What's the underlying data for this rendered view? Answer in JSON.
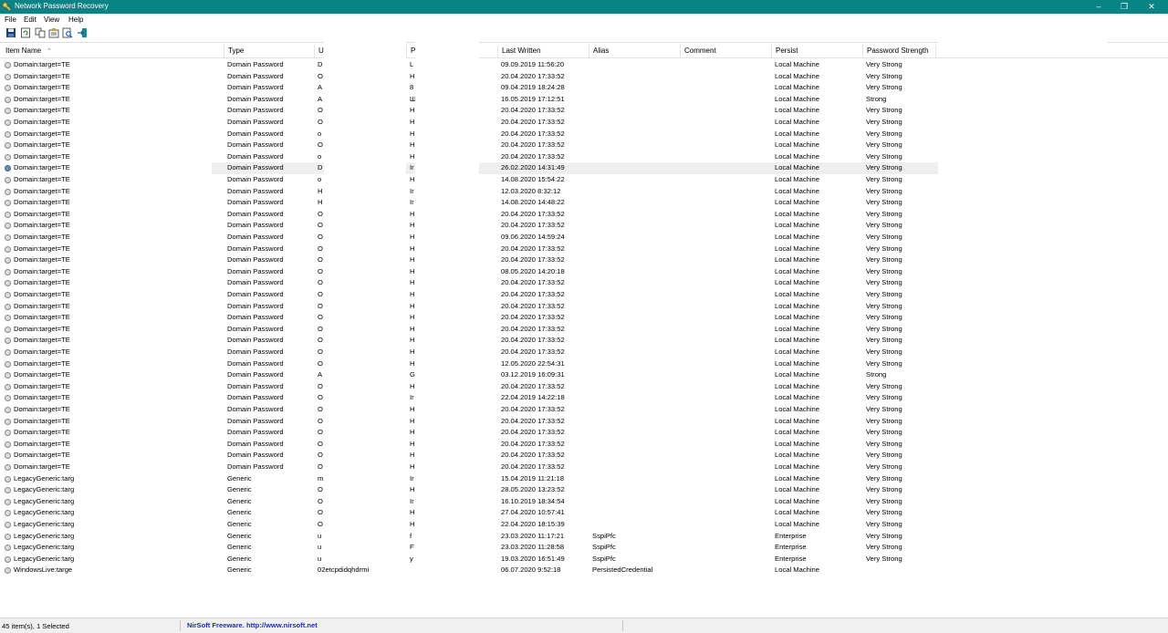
{
  "window": {
    "title": "Network Password Recovery",
    "controls": [
      "minimize",
      "maximize",
      "close"
    ]
  },
  "menu": [
    {
      "label": "File"
    },
    {
      "label": "Edit"
    },
    {
      "label": "View"
    },
    {
      "label": "Help"
    }
  ],
  "toolbar": [
    "save-icon",
    "refresh-icon",
    "copy-icon",
    "properties-icon",
    "find-icon",
    "exit-icon"
  ],
  "columns": [
    {
      "key": "name",
      "label": "Item Name"
    },
    {
      "key": "type",
      "label": "Type"
    },
    {
      "key": "user",
      "label": "U"
    },
    {
      "key": "pass",
      "label": "P"
    },
    {
      "key": "written",
      "label": "Last Written"
    },
    {
      "key": "alias",
      "label": "Alias"
    },
    {
      "key": "comment",
      "label": "Comment"
    },
    {
      "key": "persist",
      "label": "Persist"
    },
    {
      "key": "strength",
      "label": "Password Strength"
    }
  ],
  "sort_indicator": "⌃",
  "rows": [
    {
      "name": "Domain:target=TE",
      "type": "Domain Password",
      "user": "D",
      "pass": "L",
      "written": "09.09.2019 11:56:20",
      "alias": "",
      "persist": "Local Machine",
      "strength": "Very Strong"
    },
    {
      "name": "Domain:target=TE",
      "type": "Domain Password",
      "user": "O",
      "pass": "H",
      "written": "20.04.2020 17:33:52",
      "alias": "",
      "persist": "Local Machine",
      "strength": "Very Strong"
    },
    {
      "name": "Domain:target=TE",
      "type": "Domain Password",
      "user": "A",
      "pass": "8",
      "written": "09.04.2019 18:24:28",
      "alias": "",
      "persist": "Local Machine",
      "strength": "Very Strong"
    },
    {
      "name": "Domain:target=TE",
      "type": "Domain Password",
      "user": "A",
      "pass": "Ш",
      "written": "16.05.2019 17:12:51",
      "alias": "",
      "persist": "Local Machine",
      "strength": "Strong"
    },
    {
      "name": "Domain:target=TE",
      "type": "Domain Password",
      "user": "O",
      "pass": "H",
      "written": "20.04.2020 17:33:52",
      "alias": "",
      "persist": "Local Machine",
      "strength": "Very Strong"
    },
    {
      "name": "Domain:target=TE",
      "type": "Domain Password",
      "user": "O",
      "pass": "H",
      "written": "20.04.2020 17:33:52",
      "alias": "",
      "persist": "Local Machine",
      "strength": "Very Strong"
    },
    {
      "name": "Domain:target=TE",
      "type": "Domain Password",
      "user": "o",
      "pass": "H",
      "written": "20.04.2020 17:33:52",
      "alias": "",
      "persist": "Local Machine",
      "strength": "Very Strong"
    },
    {
      "name": "Domain:target=TE",
      "type": "Domain Password",
      "user": "O",
      "pass": "H",
      "written": "20.04.2020 17:33:52",
      "alias": "",
      "persist": "Local Machine",
      "strength": "Very Strong"
    },
    {
      "name": "Domain:target=TE",
      "type": "Domain Password",
      "user": "o",
      "pass": "H",
      "written": "20.04.2020 17:33:52",
      "alias": "",
      "persist": "Local Machine",
      "strength": "Very Strong"
    },
    {
      "name": "Domain:target=TE",
      "type": "Domain Password",
      "user": "D",
      "pass": "Ir",
      "written": "26.02.2020 14:31:49",
      "alias": "",
      "persist": "Local Machine",
      "strength": "Very Strong",
      "selected": true
    },
    {
      "name": "Domain:target=TE",
      "type": "Domain Password",
      "user": "o",
      "pass": "H",
      "written": "14.08.2020 15:54:22",
      "alias": "",
      "persist": "Local Machine",
      "strength": "Very Strong"
    },
    {
      "name": "Domain:target=TE",
      "type": "Domain Password",
      "user": "H",
      "pass": "Ir",
      "written": "12.03.2020 8:32:12",
      "alias": "",
      "persist": "Local Machine",
      "strength": "Very Strong"
    },
    {
      "name": "Domain:target=TE",
      "type": "Domain Password",
      "user": "H",
      "pass": "Ir",
      "written": "14.08.2020 14:48:22",
      "alias": "",
      "persist": "Local Machine",
      "strength": "Very Strong"
    },
    {
      "name": "Domain:target=TE",
      "type": "Domain Password",
      "user": "O",
      "pass": "H",
      "written": "20.04.2020 17:33:52",
      "alias": "",
      "persist": "Local Machine",
      "strength": "Very Strong"
    },
    {
      "name": "Domain:target=TE",
      "type": "Domain Password",
      "user": "O",
      "pass": "H",
      "written": "20.04.2020 17:33:52",
      "alias": "",
      "persist": "Local Machine",
      "strength": "Very Strong"
    },
    {
      "name": "Domain:target=TE",
      "type": "Domain Password",
      "user": "O",
      "pass": "H",
      "written": "09.06.2020 14:59:24",
      "alias": "",
      "persist": "Local Machine",
      "strength": "Very Strong"
    },
    {
      "name": "Domain:target=TE",
      "type": "Domain Password",
      "user": "O",
      "pass": "H",
      "written": "20.04.2020 17:33:52",
      "alias": "",
      "persist": "Local Machine",
      "strength": "Very Strong"
    },
    {
      "name": "Domain:target=TE",
      "type": "Domain Password",
      "user": "O",
      "pass": "H",
      "written": "20.04.2020 17:33:52",
      "alias": "",
      "persist": "Local Machine",
      "strength": "Very Strong"
    },
    {
      "name": "Domain:target=TE",
      "type": "Domain Password",
      "user": "O",
      "pass": "H",
      "written": "08.05.2020 14:20:18",
      "alias": "",
      "persist": "Local Machine",
      "strength": "Very Strong"
    },
    {
      "name": "Domain:target=TE",
      "type": "Domain Password",
      "user": "O",
      "pass": "H",
      "written": "20.04.2020 17:33:52",
      "alias": "",
      "persist": "Local Machine",
      "strength": "Very Strong"
    },
    {
      "name": "Domain:target=TE",
      "type": "Domain Password",
      "user": "O",
      "pass": "H",
      "written": "20.04.2020 17:33:52",
      "alias": "",
      "persist": "Local Machine",
      "strength": "Very Strong"
    },
    {
      "name": "Domain:target=TE",
      "type": "Domain Password",
      "user": "O",
      "pass": "H",
      "written": "20.04.2020 17:33:52",
      "alias": "",
      "persist": "Local Machine",
      "strength": "Very Strong"
    },
    {
      "name": "Domain:target=TE",
      "type": "Domain Password",
      "user": "O",
      "pass": "H",
      "written": "20.04.2020 17:33:52",
      "alias": "",
      "persist": "Local Machine",
      "strength": "Very Strong"
    },
    {
      "name": "Domain:target=TE",
      "type": "Domain Password",
      "user": "O",
      "pass": "H",
      "written": "20.04.2020 17:33:52",
      "alias": "",
      "persist": "Local Machine",
      "strength": "Very Strong"
    },
    {
      "name": "Domain:target=TE",
      "type": "Domain Password",
      "user": "O",
      "pass": "H",
      "written": "20.04.2020 17:33:52",
      "alias": "",
      "persist": "Local Machine",
      "strength": "Very Strong"
    },
    {
      "name": "Domain:target=TE",
      "type": "Domain Password",
      "user": "O",
      "pass": "H",
      "written": "20.04.2020 17:33:52",
      "alias": "",
      "persist": "Local Machine",
      "strength": "Very Strong"
    },
    {
      "name": "Domain:target=TE",
      "type": "Domain Password",
      "user": "O",
      "pass": "H",
      "written": "12.05.2020 22:54:31",
      "alias": "",
      "persist": "Local Machine",
      "strength": "Very Strong"
    },
    {
      "name": "Domain:target=TE",
      "type": "Domain Password",
      "user": "A",
      "pass": "G",
      "written": "03.12.2019 16:09:31",
      "alias": "",
      "persist": "Local Machine",
      "strength": "Strong"
    },
    {
      "name": "Domain:target=TE",
      "type": "Domain Password",
      "user": "O",
      "pass": "H",
      "written": "20.04.2020 17:33:52",
      "alias": "",
      "persist": "Local Machine",
      "strength": "Very Strong"
    },
    {
      "name": "Domain:target=TE",
      "type": "Domain Password",
      "user": "O",
      "pass": "Ir",
      "written": "22.04.2019 14:22:18",
      "alias": "",
      "persist": "Local Machine",
      "strength": "Very Strong"
    },
    {
      "name": "Domain:target=TE",
      "type": "Domain Password",
      "user": "O",
      "pass": "H",
      "written": "20.04.2020 17:33:52",
      "alias": "",
      "persist": "Local Machine",
      "strength": "Very Strong"
    },
    {
      "name": "Domain:target=TE",
      "type": "Domain Password",
      "user": "O",
      "pass": "H",
      "written": "20.04.2020 17:33:52",
      "alias": "",
      "persist": "Local Machine",
      "strength": "Very Strong"
    },
    {
      "name": "Domain:target=TE",
      "type": "Domain Password",
      "user": "O",
      "pass": "H",
      "written": "20.04.2020 17:33:52",
      "alias": "",
      "persist": "Local Machine",
      "strength": "Very Strong"
    },
    {
      "name": "Domain:target=TE",
      "type": "Domain Password",
      "user": "O",
      "pass": "H",
      "written": "20.04.2020 17:33:52",
      "alias": "",
      "persist": "Local Machine",
      "strength": "Very Strong"
    },
    {
      "name": "Domain:target=TE",
      "type": "Domain Password",
      "user": "O",
      "pass": "H",
      "written": "20.04.2020 17:33:52",
      "alias": "",
      "persist": "Local Machine",
      "strength": "Very Strong"
    },
    {
      "name": "Domain:target=TE",
      "type": "Domain Password",
      "user": "O",
      "pass": "H",
      "written": "20.04.2020 17:33:52",
      "alias": "",
      "persist": "Local Machine",
      "strength": "Very Strong"
    },
    {
      "name": "LegacyGeneric:targ",
      "type": "Generic",
      "user": "m",
      "pass": "Ir",
      "written": "15.04.2019 11:21:18",
      "alias": "",
      "persist": "Local Machine",
      "strength": "Very Strong"
    },
    {
      "name": "LegacyGeneric:targ",
      "type": "Generic",
      "user": "O",
      "pass": "H",
      "written": "28.05.2020 13:23:52",
      "alias": "",
      "persist": "Local Machine",
      "strength": "Very Strong"
    },
    {
      "name": "LegacyGeneric:targ",
      "type": "Generic",
      "user": "O",
      "pass": "Ir",
      "written": "16.10.2019 18:34:54",
      "alias": "",
      "persist": "Local Machine",
      "strength": "Very Strong"
    },
    {
      "name": "LegacyGeneric:targ",
      "type": "Generic",
      "user": "O",
      "pass": "H",
      "written": "27.04.2020 10:57:41",
      "alias": "",
      "persist": "Local Machine",
      "strength": "Very Strong"
    },
    {
      "name": "LegacyGeneric:targ",
      "type": "Generic",
      "user": "O",
      "pass": "H",
      "written": "22.04.2020 18:15:39",
      "alias": "",
      "persist": "Local Machine",
      "strength": "Very Strong"
    },
    {
      "name": "LegacyGeneric:targ",
      "type": "Generic",
      "user": "u",
      "pass": "f",
      "written": "23.03.2020 11:17:21",
      "alias": "SspiPfc",
      "persist": "Enterprise",
      "strength": "Very Strong"
    },
    {
      "name": "LegacyGeneric:targ",
      "type": "Generic",
      "user": "u",
      "pass": "F",
      "written": "23.03.2020 11:28:58",
      "alias": "SspiPfc",
      "persist": "Enterprise",
      "strength": "Very Strong"
    },
    {
      "name": "LegacyGeneric:targ",
      "type": "Generic",
      "user": "u",
      "pass": "y",
      "written": "19.03.2020 16:51:49",
      "alias": "SspiPfc",
      "persist": "Enterprise",
      "strength": "Very Strong"
    },
    {
      "name": "WindowsLive:targe",
      "type": "Generic",
      "user": "02etcpdidqhdrmi",
      "pass": "",
      "written": "06.07.2020 9:52:18",
      "alias": "PersistedCredential",
      "persist": "Local Machine",
      "strength": ""
    }
  ],
  "status": {
    "count": "45 item(s), 1 Selected",
    "link": "NirSoft Freeware.  http://www.nirsoft.net"
  }
}
